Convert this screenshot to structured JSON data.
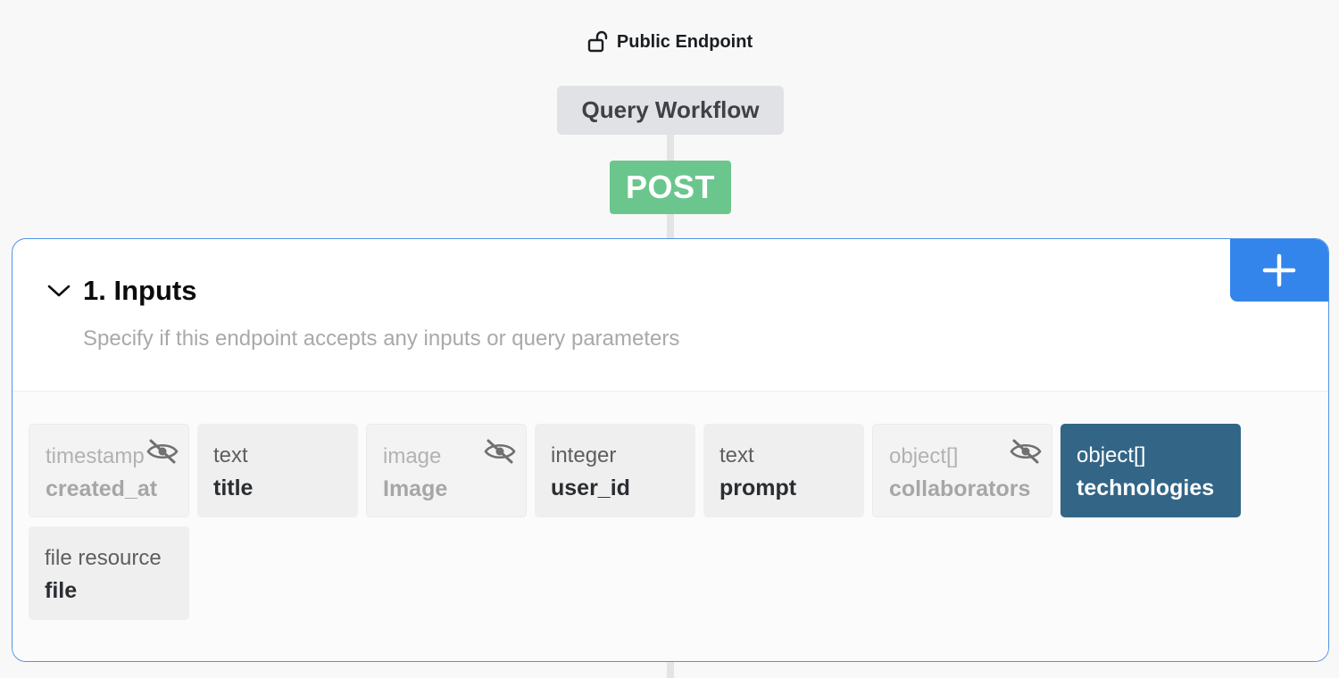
{
  "endpoint": {
    "access_label": "Public Endpoint",
    "access_icon": "unlock-icon",
    "workflow_title": "Query Workflow",
    "method": "POST",
    "method_color": "#6bc68d"
  },
  "inputs_section": {
    "title": "1. Inputs",
    "description": "Specify if this endpoint accepts any inputs or query parameters",
    "accent_color": "#3485eb",
    "add_icon": "plus-icon",
    "collapse_icon": "chevron-down-icon",
    "fields": [
      {
        "type": "timestamp",
        "name": "created_at",
        "hidden": true,
        "selected": false
      },
      {
        "type": "text",
        "name": "title",
        "hidden": false,
        "selected": false
      },
      {
        "type": "image",
        "name": "Image",
        "hidden": true,
        "selected": false
      },
      {
        "type": "integer",
        "name": "user_id",
        "hidden": false,
        "selected": false
      },
      {
        "type": "text",
        "name": "prompt",
        "hidden": false,
        "selected": false
      },
      {
        "type": "object[]",
        "name": "collaborators",
        "hidden": true,
        "selected": false
      },
      {
        "type": "object[]",
        "name": "technologies",
        "hidden": false,
        "selected": true,
        "selected_color": "#336587"
      },
      {
        "type": "file resource",
        "name": "file",
        "hidden": false,
        "selected": false
      }
    ]
  }
}
